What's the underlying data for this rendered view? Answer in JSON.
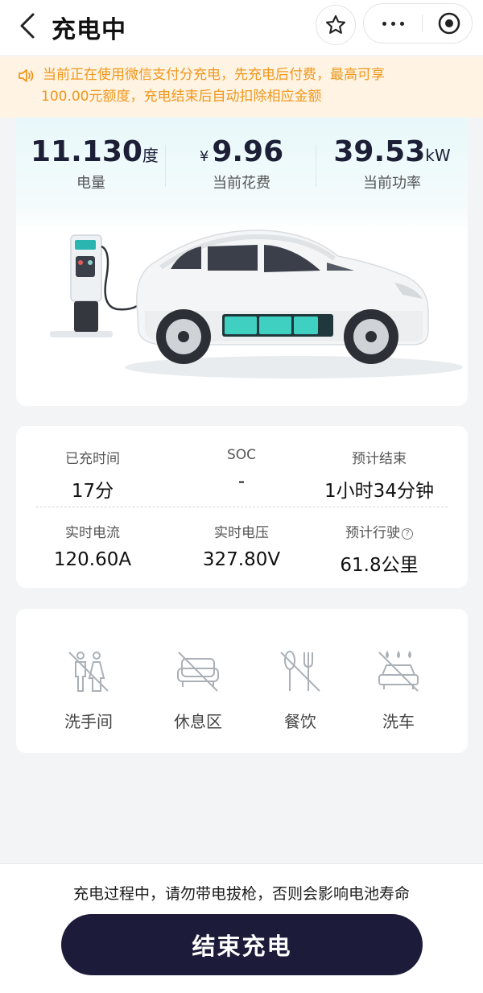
{
  "header": {
    "title": "充电中"
  },
  "notice": {
    "line1": "当前正在使用微信支付分充电，先充电后付费，最高可享",
    "line2": "100.00元额度，充电结束后自动扣除相应金额",
    "color": "#f0961c"
  },
  "summary": {
    "energy": {
      "value": "11.130",
      "unit": "度",
      "label": "电量"
    },
    "cost": {
      "currency": "¥",
      "value": "9.96",
      "label": "当前花费"
    },
    "power": {
      "value": "39.53",
      "unit": "kW",
      "label": "当前功率"
    }
  },
  "details": {
    "charged_time": {
      "label": "已充时间",
      "value": "17分"
    },
    "soc": {
      "label": "SOC",
      "value": "-"
    },
    "est_end": {
      "label": "预计结束",
      "value": "1小时34分钟"
    },
    "current": {
      "label": "实时电流",
      "value": "120.60A"
    },
    "voltage": {
      "label": "实时电压",
      "value": "327.80V"
    },
    "est_range": {
      "label": "预计行驶",
      "value": "61.8公里",
      "help_icon": "question-circle-icon"
    }
  },
  "amenities": [
    {
      "label": "洗手间",
      "icon": "restroom-icon"
    },
    {
      "label": "休息区",
      "icon": "rest-area-icon"
    },
    {
      "label": "餐饮",
      "icon": "dining-icon"
    },
    {
      "label": "洗车",
      "icon": "car-wash-icon"
    }
  ],
  "bottom": {
    "warning": "充电过程中，请勿带电拔枪，否则会影响电池寿命",
    "end_button": "结束充电",
    "button_color": "#1d1b3a"
  }
}
